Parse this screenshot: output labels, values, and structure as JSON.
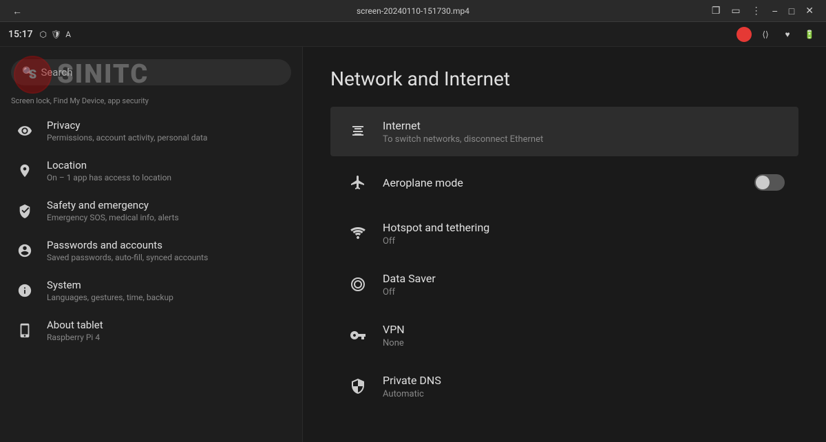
{
  "window_bar": {
    "title": "screen-20240110-151730.mp4",
    "back_icon": "←",
    "controls": [
      "−",
      "□",
      "×"
    ]
  },
  "status_bar": {
    "time": "15:17",
    "icons": [
      "usb",
      "shield",
      "a"
    ]
  },
  "watermark": {
    "logo_text": "S",
    "brand_text": "SINITC"
  },
  "search": {
    "placeholder": "Search",
    "hint": "Screen lock, Find My Device, app security"
  },
  "sidebar": {
    "items": [
      {
        "id": "privacy",
        "title": "Privacy",
        "subtitle": "Permissions, account activity, personal data",
        "icon": "👁"
      },
      {
        "id": "location",
        "title": "Location",
        "subtitle": "On – 1 app has access to location",
        "icon": "📍"
      },
      {
        "id": "safety",
        "title": "Safety and emergency",
        "subtitle": "Emergency SOS, medical info, alerts",
        "icon": "✳"
      },
      {
        "id": "passwords",
        "title": "Passwords and accounts",
        "subtitle": "Saved passwords, auto-fill, synced accounts",
        "icon": "👤"
      },
      {
        "id": "system",
        "title": "System",
        "subtitle": "Languages, gestures, time, backup",
        "icon": "ℹ"
      },
      {
        "id": "about",
        "title": "About tablet",
        "subtitle": "Raspberry Pi 4",
        "icon": "📱"
      }
    ]
  },
  "content": {
    "title": "Network and Internet",
    "items": [
      {
        "id": "internet",
        "title": "Internet",
        "subtitle": "To switch networks, disconnect Ethernet",
        "icon": "⟷",
        "selected": true,
        "control": null
      },
      {
        "id": "aeroplane",
        "title": "Aeroplane mode",
        "subtitle": "",
        "icon": "✈",
        "selected": false,
        "control": "toggle_off"
      },
      {
        "id": "hotspot",
        "title": "Hotspot and tethering",
        "subtitle": "Off",
        "icon": "📡",
        "selected": false,
        "control": null
      },
      {
        "id": "datasaver",
        "title": "Data Saver",
        "subtitle": "Off",
        "icon": "◎",
        "selected": false,
        "control": null
      },
      {
        "id": "vpn",
        "title": "VPN",
        "subtitle": "None",
        "icon": "🔑",
        "selected": false,
        "control": null
      },
      {
        "id": "privateDNS",
        "title": "Private DNS",
        "subtitle": "Automatic",
        "icon": "🔒",
        "selected": false,
        "control": null
      }
    ]
  }
}
